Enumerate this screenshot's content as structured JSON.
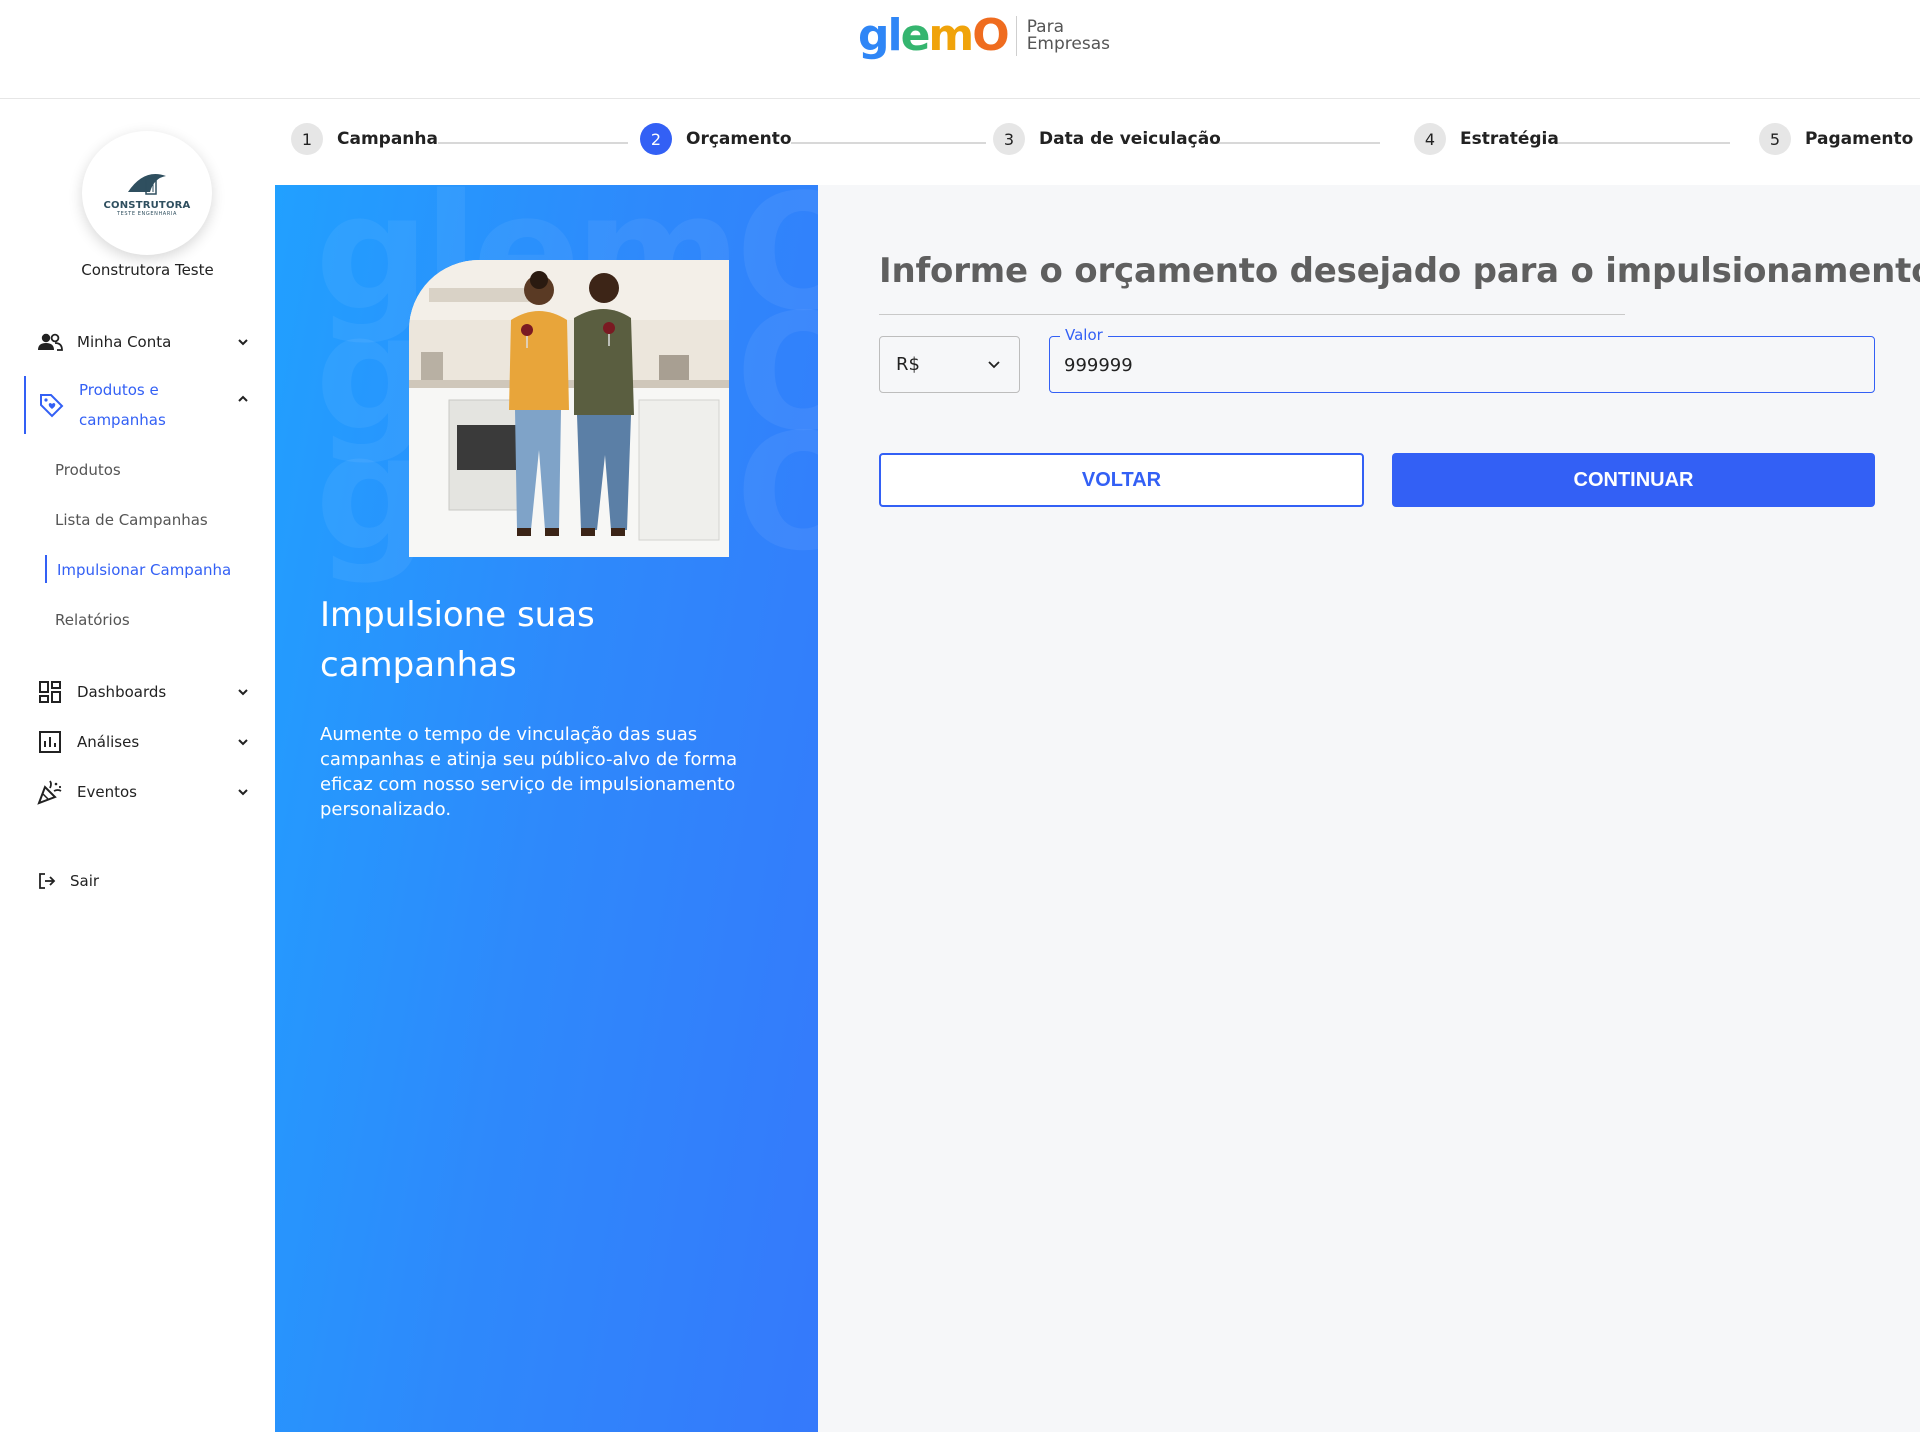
{
  "header": {
    "logo_text": "glemO",
    "logo_sub_line1": "Para",
    "logo_sub_line2": "Empresas"
  },
  "sidebar": {
    "avatar_brand": "CONSTRUTORA",
    "avatar_brand_sub": "TESTE ENGENHARIA",
    "company_name": "Construtora Teste",
    "items": [
      {
        "label": "Minha Conta",
        "icon": "people-icon"
      },
      {
        "label_line1": "Produtos e",
        "label_line2": "campanhas",
        "icon": "tag-heart-icon"
      },
      {
        "label": "Dashboards",
        "icon": "dashboard-icon"
      },
      {
        "label": "Análises",
        "icon": "analytics-icon"
      },
      {
        "label": "Eventos",
        "icon": "celebration-icon"
      }
    ],
    "sub_items": [
      "Produtos",
      "Lista de Campanhas",
      "Impulsionar Campanha",
      "Relatórios"
    ],
    "logout_label": "Sair"
  },
  "stepper": {
    "steps": [
      {
        "number": "1",
        "label": "Campanha"
      },
      {
        "number": "2",
        "label": "Orçamento"
      },
      {
        "number": "3",
        "label": "Data de veiculação"
      },
      {
        "number": "4",
        "label": "Estratégia"
      },
      {
        "number": "5",
        "label": "Pagamento"
      }
    ],
    "active_step": 2
  },
  "promo": {
    "watermark": "glemO",
    "title": "Impulsione suas campanhas",
    "text": "Aumente o tempo de vinculação das suas campanhas e atinja seu público-alvo de forma eficaz com nosso serviço de impulsionamento personalizado."
  },
  "form": {
    "title": "Informe o orçamento desejado para o impulsionamento",
    "currency": "R$",
    "valor_label": "Valor",
    "valor_value": "999999",
    "back_label": "VOLTAR",
    "continue_label": "CONTINUAR"
  },
  "colors": {
    "primary": "#3360f5",
    "promo_gradient_start": "#21a0ff",
    "promo_gradient_end": "#3579fb"
  }
}
